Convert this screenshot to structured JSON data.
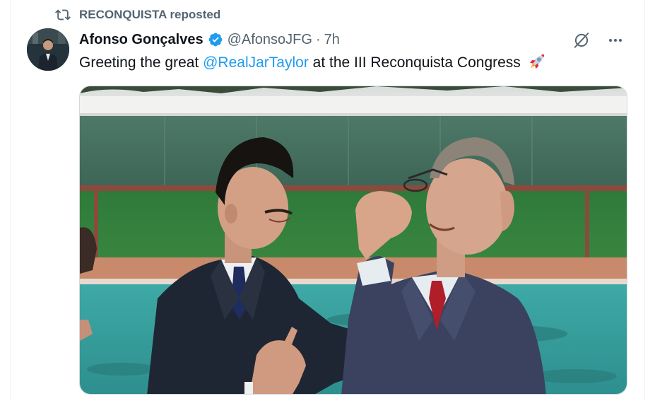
{
  "repost": {
    "label": "RECONQUISTA reposted",
    "icon": "retweet-icon"
  },
  "author": {
    "display_name": "Afonso Gonçalves",
    "handle": "@AfonsoJFG",
    "separator": "·",
    "time": "7h",
    "verified_color": "#1d9bf0"
  },
  "tweet": {
    "text_before": "Greeting the great ",
    "mention": "@RealJarTaylor",
    "text_after": " at the III Reconquista Congress",
    "emoji": "rocket-icon"
  },
  "actions": {
    "grok_icon": "grok-icon",
    "more_icon": "more-options-icon"
  },
  "media": {
    "description_icon": "photo"
  },
  "colors": {
    "accent": "#1d9bf0",
    "secondary_text": "#536471",
    "primary_text": "#0f1419"
  }
}
